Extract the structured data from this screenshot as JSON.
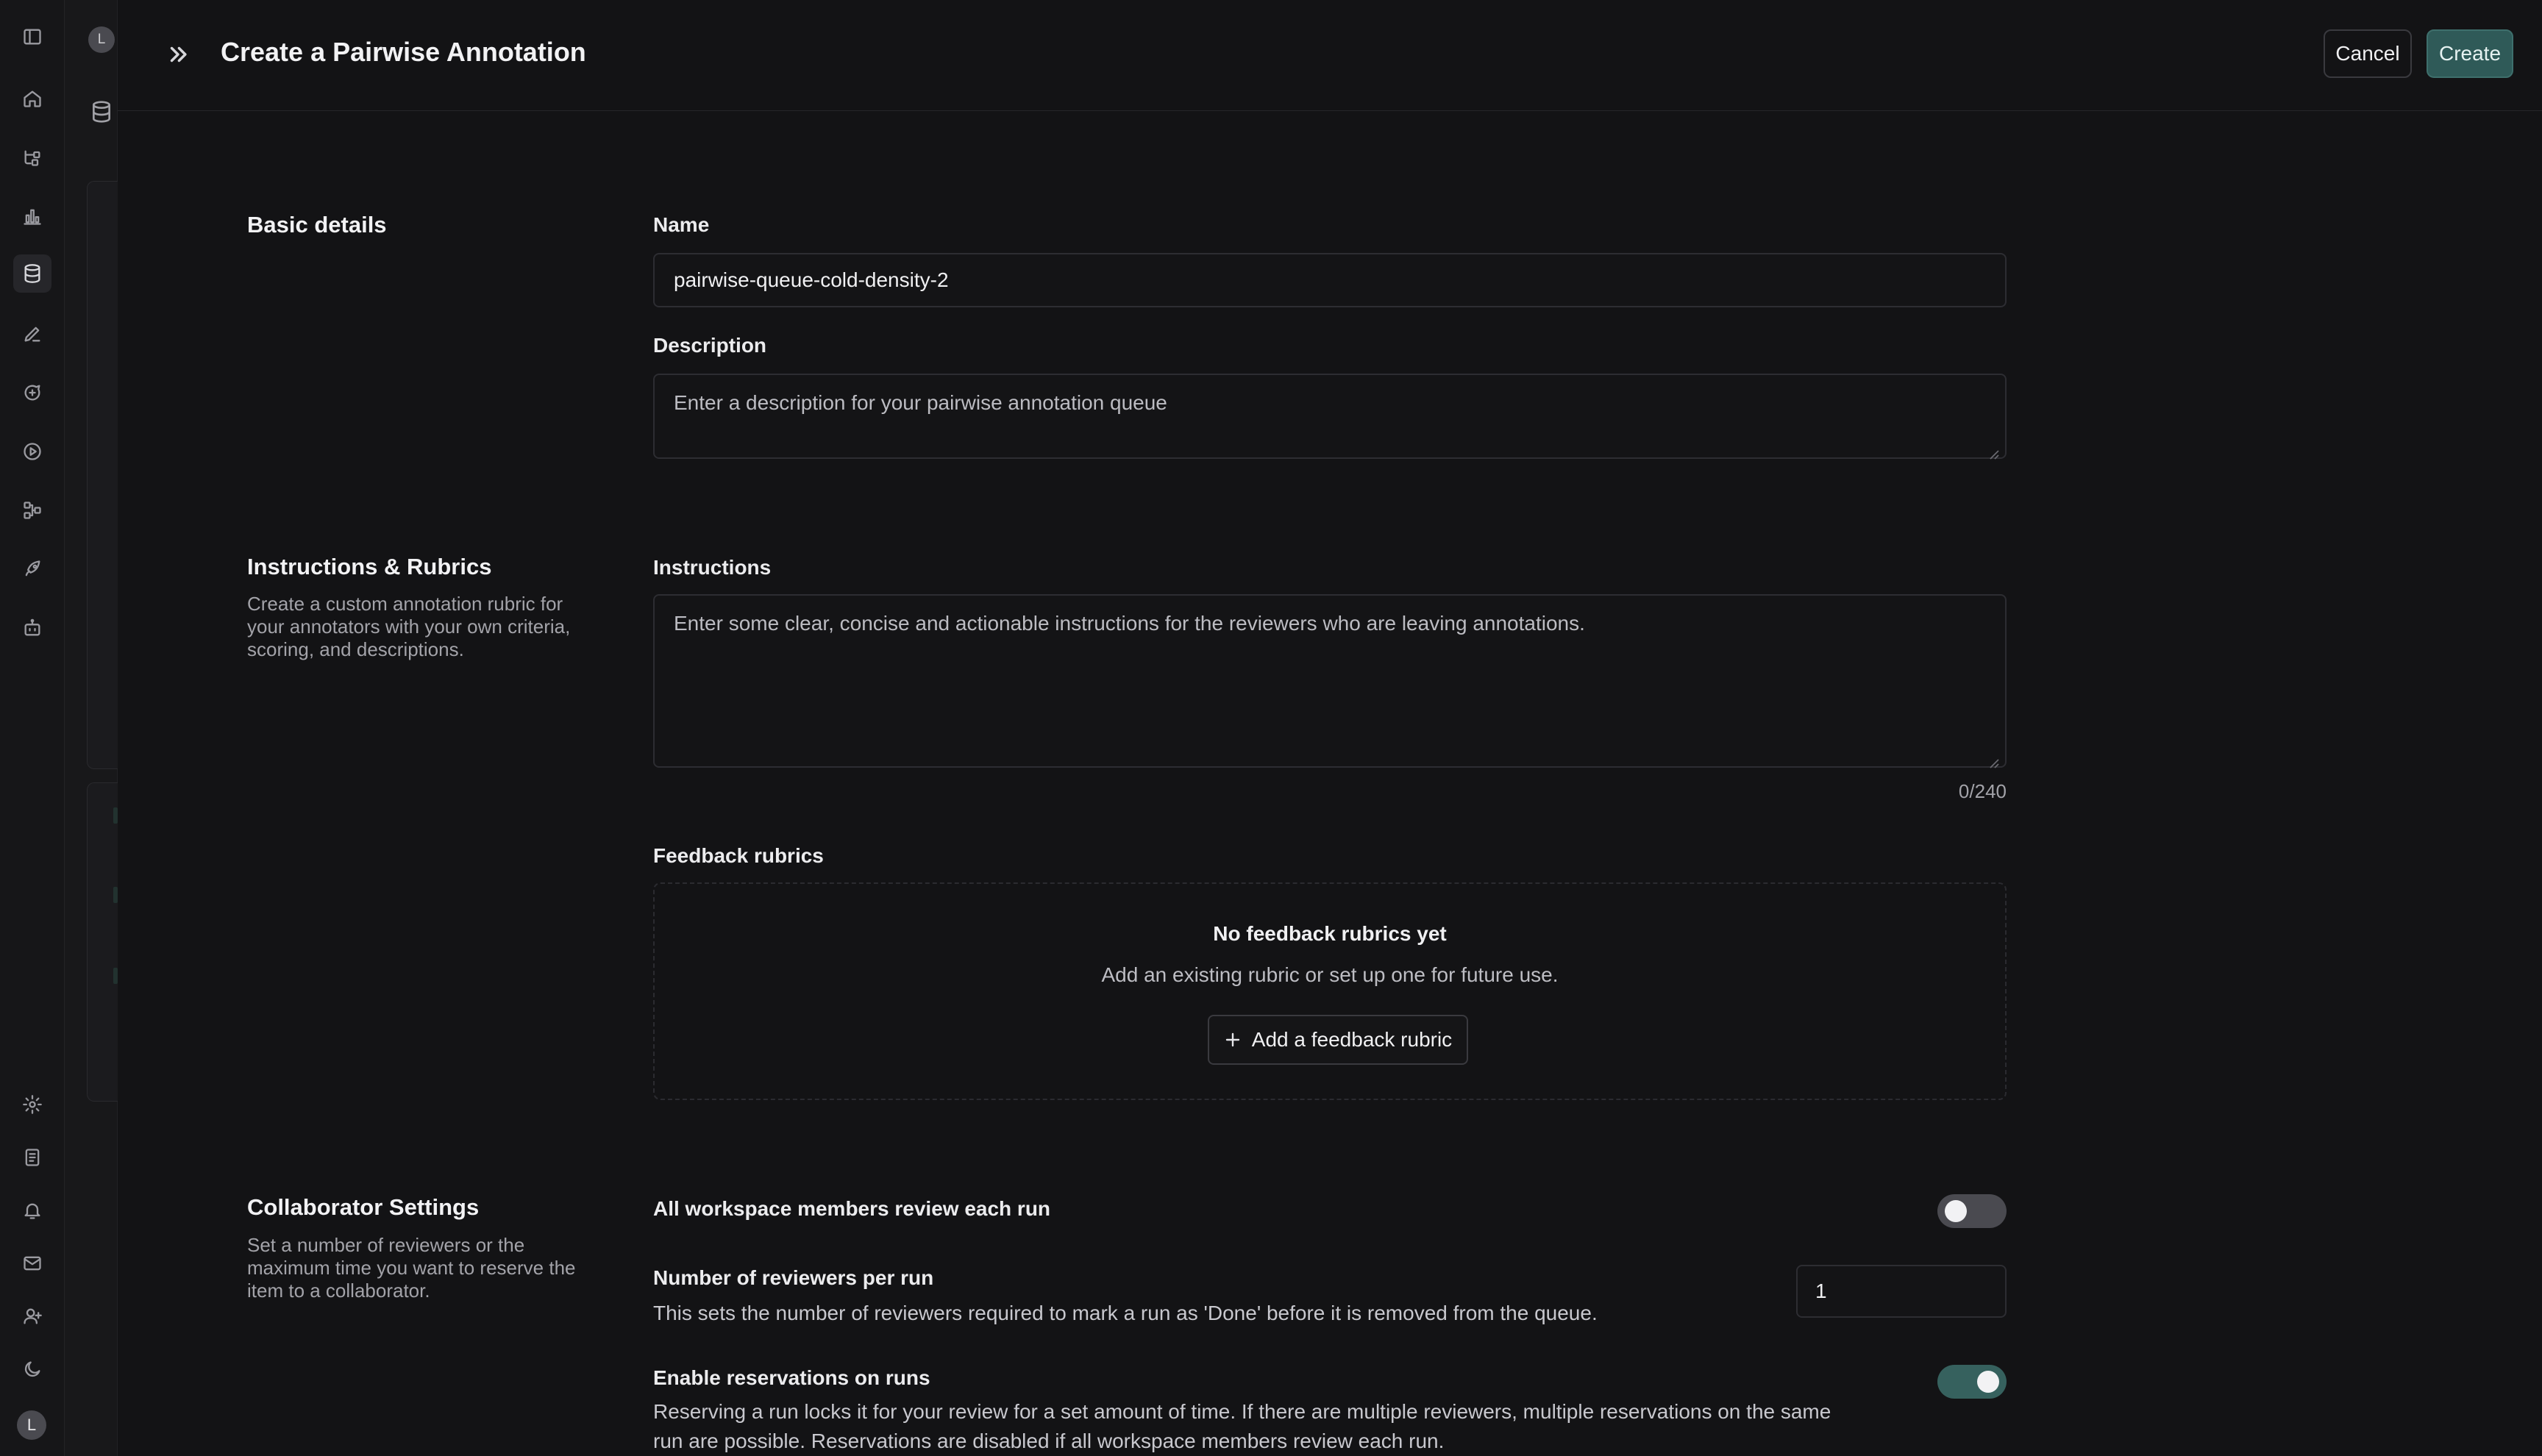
{
  "rail": {
    "icons": [
      "sidebar-toggle-icon",
      "home-icon",
      "tracing-icon",
      "chart-icon",
      "database-icon",
      "pen-icon",
      "chat-plus-icon",
      "play-circle-icon",
      "workflow-icon",
      "rocket-icon",
      "robot-icon",
      "settings-icon",
      "docs-icon",
      "bell-plus-icon",
      "mail-icon",
      "user-plus-icon",
      "moon-icon"
    ],
    "avatar_initial": "L"
  },
  "secondary": {
    "avatar_initial": "L"
  },
  "header": {
    "title": "Create a Pairwise Annotation",
    "cancel_label": "Cancel",
    "create_label": "Create"
  },
  "basic": {
    "section_title": "Basic details",
    "name_label": "Name",
    "name_value": "pairwise-queue-cold-density-2",
    "description_label": "Description",
    "description_placeholder": "Enter a description for your pairwise annotation queue"
  },
  "instructions": {
    "section_title": "Instructions & Rubrics",
    "section_desc": "Create a custom annotation rubric for your annotators with your own criteria, scoring, and descriptions.",
    "label": "Instructions",
    "placeholder": "Enter some clear, concise and actionable instructions for the reviewers who are leaving annotations.",
    "counter": "0/240"
  },
  "rubrics": {
    "label": "Feedback rubrics",
    "empty_title": "No feedback rubrics yet",
    "empty_sub": "Add an existing rubric or set up one for future use.",
    "add_label": "Add a feedback rubric"
  },
  "collab": {
    "section_title": "Collaborator Settings",
    "section_desc": "Set a number of reviewers or the maximum time you want to reserve the item to a collaborator.",
    "all_members_label": "All workspace members review each run",
    "all_members_on": false,
    "reviewers_label": "Number of reviewers per run",
    "reviewers_desc": "This sets the number of reviewers required to mark a run as 'Done' before it is removed from the queue.",
    "reviewers_value": "1",
    "reservations_label": "Enable reservations on runs",
    "reservations_on": true,
    "reservations_desc": "Reserving a run locks it for your review for a set amount of time. If there are multiple reviewers, multiple reservations on the same run are possible. Reservations are disabled if all workspace members review each run."
  },
  "colors": {
    "accent": "#2f5a58",
    "toggle_on": "#36615e",
    "toggle_off": "#4a4a50"
  }
}
